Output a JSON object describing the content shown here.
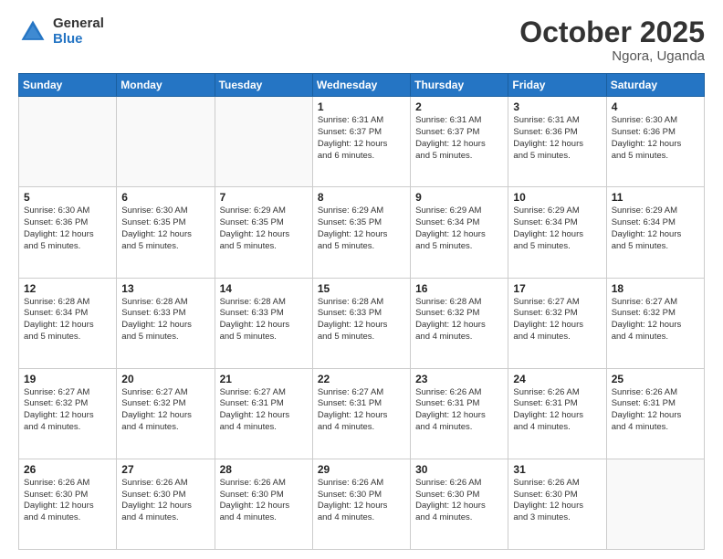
{
  "header": {
    "logo_general": "General",
    "logo_blue": "Blue",
    "month": "October 2025",
    "location": "Ngora, Uganda"
  },
  "days_of_week": [
    "Sunday",
    "Monday",
    "Tuesday",
    "Wednesday",
    "Thursday",
    "Friday",
    "Saturday"
  ],
  "weeks": [
    [
      {
        "day": "",
        "info": ""
      },
      {
        "day": "",
        "info": ""
      },
      {
        "day": "",
        "info": ""
      },
      {
        "day": "1",
        "info": "Sunrise: 6:31 AM\nSunset: 6:37 PM\nDaylight: 12 hours\nand 6 minutes."
      },
      {
        "day": "2",
        "info": "Sunrise: 6:31 AM\nSunset: 6:37 PM\nDaylight: 12 hours\nand 5 minutes."
      },
      {
        "day": "3",
        "info": "Sunrise: 6:31 AM\nSunset: 6:36 PM\nDaylight: 12 hours\nand 5 minutes."
      },
      {
        "day": "4",
        "info": "Sunrise: 6:30 AM\nSunset: 6:36 PM\nDaylight: 12 hours\nand 5 minutes."
      }
    ],
    [
      {
        "day": "5",
        "info": "Sunrise: 6:30 AM\nSunset: 6:36 PM\nDaylight: 12 hours\nand 5 minutes."
      },
      {
        "day": "6",
        "info": "Sunrise: 6:30 AM\nSunset: 6:35 PM\nDaylight: 12 hours\nand 5 minutes."
      },
      {
        "day": "7",
        "info": "Sunrise: 6:29 AM\nSunset: 6:35 PM\nDaylight: 12 hours\nand 5 minutes."
      },
      {
        "day": "8",
        "info": "Sunrise: 6:29 AM\nSunset: 6:35 PM\nDaylight: 12 hours\nand 5 minutes."
      },
      {
        "day": "9",
        "info": "Sunrise: 6:29 AM\nSunset: 6:34 PM\nDaylight: 12 hours\nand 5 minutes."
      },
      {
        "day": "10",
        "info": "Sunrise: 6:29 AM\nSunset: 6:34 PM\nDaylight: 12 hours\nand 5 minutes."
      },
      {
        "day": "11",
        "info": "Sunrise: 6:29 AM\nSunset: 6:34 PM\nDaylight: 12 hours\nand 5 minutes."
      }
    ],
    [
      {
        "day": "12",
        "info": "Sunrise: 6:28 AM\nSunset: 6:34 PM\nDaylight: 12 hours\nand 5 minutes."
      },
      {
        "day": "13",
        "info": "Sunrise: 6:28 AM\nSunset: 6:33 PM\nDaylight: 12 hours\nand 5 minutes."
      },
      {
        "day": "14",
        "info": "Sunrise: 6:28 AM\nSunset: 6:33 PM\nDaylight: 12 hours\nand 5 minutes."
      },
      {
        "day": "15",
        "info": "Sunrise: 6:28 AM\nSunset: 6:33 PM\nDaylight: 12 hours\nand 5 minutes."
      },
      {
        "day": "16",
        "info": "Sunrise: 6:28 AM\nSunset: 6:32 PM\nDaylight: 12 hours\nand 4 minutes."
      },
      {
        "day": "17",
        "info": "Sunrise: 6:27 AM\nSunset: 6:32 PM\nDaylight: 12 hours\nand 4 minutes."
      },
      {
        "day": "18",
        "info": "Sunrise: 6:27 AM\nSunset: 6:32 PM\nDaylight: 12 hours\nand 4 minutes."
      }
    ],
    [
      {
        "day": "19",
        "info": "Sunrise: 6:27 AM\nSunset: 6:32 PM\nDaylight: 12 hours\nand 4 minutes."
      },
      {
        "day": "20",
        "info": "Sunrise: 6:27 AM\nSunset: 6:32 PM\nDaylight: 12 hours\nand 4 minutes."
      },
      {
        "day": "21",
        "info": "Sunrise: 6:27 AM\nSunset: 6:31 PM\nDaylight: 12 hours\nand 4 minutes."
      },
      {
        "day": "22",
        "info": "Sunrise: 6:27 AM\nSunset: 6:31 PM\nDaylight: 12 hours\nand 4 minutes."
      },
      {
        "day": "23",
        "info": "Sunrise: 6:26 AM\nSunset: 6:31 PM\nDaylight: 12 hours\nand 4 minutes."
      },
      {
        "day": "24",
        "info": "Sunrise: 6:26 AM\nSunset: 6:31 PM\nDaylight: 12 hours\nand 4 minutes."
      },
      {
        "day": "25",
        "info": "Sunrise: 6:26 AM\nSunset: 6:31 PM\nDaylight: 12 hours\nand 4 minutes."
      }
    ],
    [
      {
        "day": "26",
        "info": "Sunrise: 6:26 AM\nSunset: 6:30 PM\nDaylight: 12 hours\nand 4 minutes."
      },
      {
        "day": "27",
        "info": "Sunrise: 6:26 AM\nSunset: 6:30 PM\nDaylight: 12 hours\nand 4 minutes."
      },
      {
        "day": "28",
        "info": "Sunrise: 6:26 AM\nSunset: 6:30 PM\nDaylight: 12 hours\nand 4 minutes."
      },
      {
        "day": "29",
        "info": "Sunrise: 6:26 AM\nSunset: 6:30 PM\nDaylight: 12 hours\nand 4 minutes."
      },
      {
        "day": "30",
        "info": "Sunrise: 6:26 AM\nSunset: 6:30 PM\nDaylight: 12 hours\nand 4 minutes."
      },
      {
        "day": "31",
        "info": "Sunrise: 6:26 AM\nSunset: 6:30 PM\nDaylight: 12 hours\nand 3 minutes."
      },
      {
        "day": "",
        "info": ""
      }
    ]
  ]
}
